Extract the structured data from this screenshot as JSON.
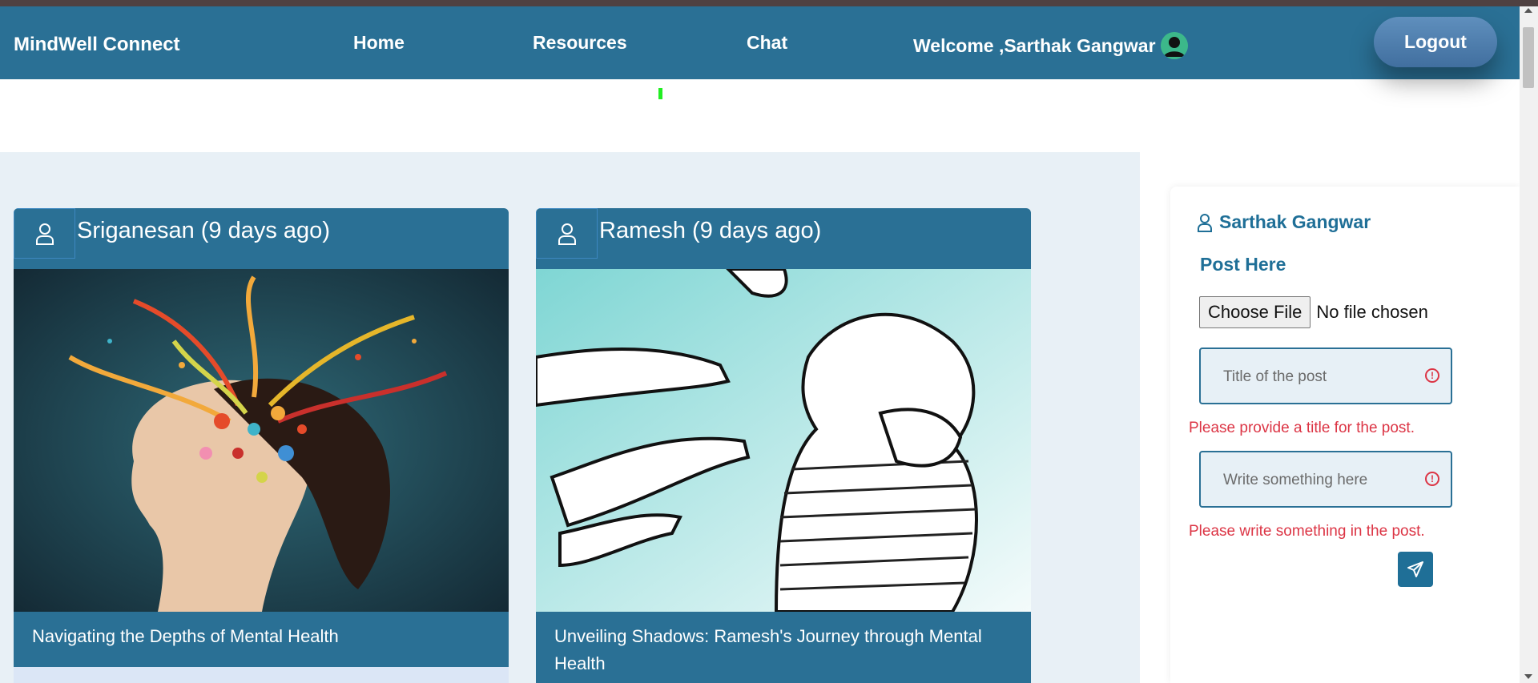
{
  "navbar": {
    "brand": "MindWell Connect",
    "links": [
      "Home",
      "Resources",
      "Chat"
    ],
    "welcome": "Welcome ,Sarthak Gangwar",
    "logout_label": "Logout"
  },
  "posts": [
    {
      "author": "Sriganesan (9 days ago)",
      "title": "Navigating the Depths of Mental Health"
    },
    {
      "author": "Ramesh (9 days ago)",
      "title": "Unveiling Shadows: Ramesh's Journey through Mental Health"
    }
  ],
  "composer": {
    "user_name": "Sarthak Gangwar",
    "heading": "Post Here",
    "choose_file_label": "Choose File",
    "file_status": "No file chosen",
    "title_placeholder": "Title of the post",
    "title_error": "Please provide a title for the post.",
    "body_placeholder": "Write something here",
    "body_error": "Please write something in the post."
  },
  "colors": {
    "primary": "#2a7095",
    "error": "#dc3545",
    "feed_bg": "#e8f0f6"
  },
  "icons": {
    "user": "user-outline-icon",
    "send": "paper-plane-icon",
    "error": "exclamation-circle-icon",
    "avatar": "user-avatar-icon"
  }
}
